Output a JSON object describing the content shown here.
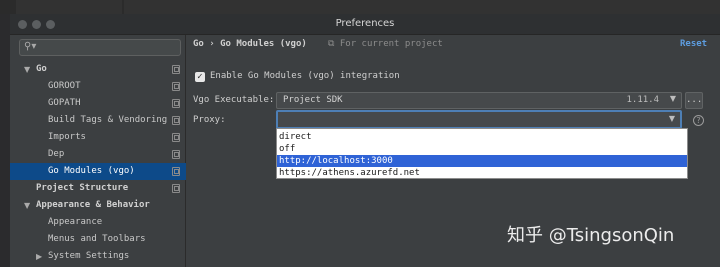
{
  "window": {
    "title": "Preferences"
  },
  "sidebar": {
    "search_placeholder": "",
    "items": [
      {
        "label": "Go",
        "expanded": true
      },
      {
        "label": "GOROOT"
      },
      {
        "label": "GOPATH"
      },
      {
        "label": "Build Tags & Vendoring"
      },
      {
        "label": "Imports"
      },
      {
        "label": "Dep"
      },
      {
        "label": "Go Modules (vgo)",
        "selected": true
      },
      {
        "label": "Project Structure"
      },
      {
        "label": "Appearance & Behavior",
        "expanded": true
      },
      {
        "label": "Appearance"
      },
      {
        "label": "Menus and Toolbars"
      },
      {
        "label": "System Settings",
        "expanded": false
      }
    ]
  },
  "main": {
    "breadcrumb": [
      "Go",
      "›",
      "Go Modules (vgo)"
    ],
    "for_project": "For current project",
    "reset_label": "Reset",
    "enable_checkbox": {
      "label": "Enable Go Modules (vgo) integration",
      "checked": true
    },
    "vgo_executable": {
      "label": "Vgo Executable:",
      "value": "Project SDK",
      "version": "1.11.4",
      "browse_label": "..."
    },
    "proxy": {
      "label": "Proxy:",
      "value": "",
      "options": [
        "direct",
        "off",
        "http://localhost:3000",
        "https://athens.azurefd.net"
      ],
      "selected_option": "http://localhost:3000"
    }
  },
  "watermark": "知乎 @TsingsonQin",
  "colors": {
    "selection": "#0d4a89",
    "popup_highlight": "#2f63d6",
    "link": "#5d9de0"
  }
}
